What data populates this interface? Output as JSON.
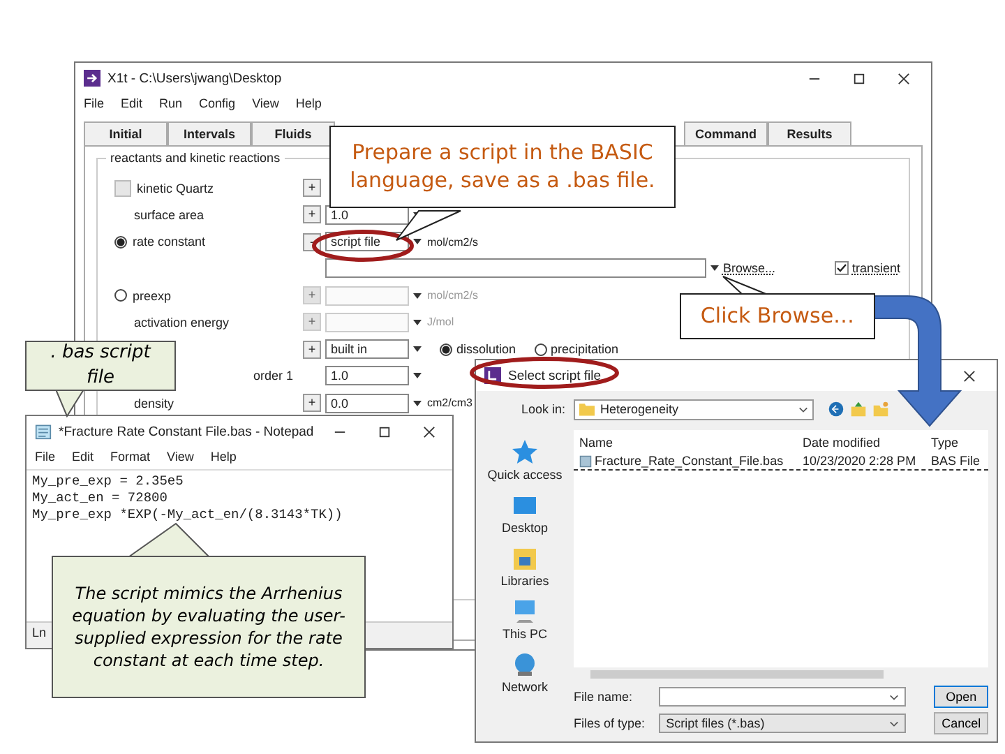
{
  "main_window": {
    "title": "X1t - C:\\Users\\jwang\\Desktop",
    "menu": [
      "File",
      "Edit",
      "Run",
      "Config",
      "View",
      "Help"
    ],
    "tabs": [
      {
        "label": "Initial",
        "selected": false
      },
      {
        "label": "Intervals",
        "selected": false
      },
      {
        "label": "Fluids",
        "selected": false
      },
      {
        "label": "Command",
        "selected": false
      },
      {
        "label": "Results",
        "selected": false
      }
    ],
    "group_title": "reactants and kinetic reactions",
    "rows": [
      {
        "kind": "check",
        "label": "kinetic Quartz",
        "checked": false,
        "button": "+"
      },
      {
        "kind": "field",
        "label": "surface area",
        "button": "+",
        "value": "1.0",
        "disabled": false
      },
      {
        "kind": "radio",
        "label": "rate constant",
        "selected": true,
        "button": "-",
        "value": "script file",
        "unit": "mol/cm2/s",
        "disabled": false
      },
      {
        "kind": "script",
        "browse": "Browse...",
        "transient": {
          "label": "transient",
          "checked": true
        }
      },
      {
        "kind": "radio",
        "label": "preexp",
        "selected": false,
        "button": "+",
        "value": "",
        "unit": "mol/cm2/s",
        "disabled": true
      },
      {
        "kind": "field",
        "label": "activation energy",
        "button": "+",
        "value": "",
        "unit": "J/mol",
        "disabled": true
      },
      {
        "kind": "direction",
        "button": "+",
        "value": "built in",
        "options": [
          {
            "label": "dissolution",
            "selected": true
          },
          {
            "label": "precipitation",
            "selected": false
          }
        ]
      },
      {
        "kind": "field",
        "label": "order 1",
        "value": "1.0",
        "disabled": false
      },
      {
        "kind": "field",
        "label": "density",
        "button": "+",
        "value": "0.0",
        "unit": "cm2/cm3",
        "disabled": false
      }
    ]
  },
  "notepad": {
    "title": "*Fracture Rate Constant File.bas - Notepad",
    "menu": [
      "File",
      "Edit",
      "Format",
      "View",
      "Help"
    ],
    "lines": [
      "My_pre_exp = 2.35e5",
      "My_act_en = 72800",
      "My_pre_exp *EXP(-My_act_en/(8.3143*TK))"
    ],
    "status": "Ln"
  },
  "dialog": {
    "title": "Select script file",
    "look_in_label": "Look in:",
    "look_in": "Heterogeneity",
    "places": [
      {
        "label": "Quick access",
        "kind": "star"
      },
      {
        "label": "Desktop",
        "kind": "desktop"
      },
      {
        "label": "Libraries",
        "kind": "library"
      },
      {
        "label": "This PC",
        "kind": "pc"
      },
      {
        "label": "Network",
        "kind": "network"
      }
    ],
    "columns": [
      "Name",
      "Date modified",
      "Type"
    ],
    "files": [
      {
        "name": "Fracture_Rate_Constant_File.bas",
        "date": "10/23/2020 2:28 PM",
        "type": "BAS File",
        "selected": true
      }
    ],
    "file_name_label": "File name:",
    "type_label": "Files of type:",
    "type_value": "Script files (*.bas)",
    "buttons": [
      "Open",
      "Cancel"
    ]
  },
  "callouts": [
    {
      "kind": "note",
      "text": "Prepare a script in the BASIC language, save as a .bas file."
    },
    {
      "kind": "note",
      "text": "Click Browse…"
    },
    {
      "kind": "tip",
      "text": ". bas script file"
    },
    {
      "kind": "tip",
      "text": "The script mimics the Arrhenius equation by evaluating the user-supplied expression for the rate constant at each time step."
    }
  ]
}
